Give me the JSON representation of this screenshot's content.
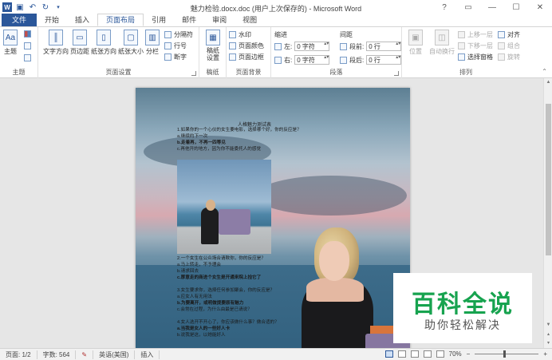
{
  "window": {
    "title": "魅力检验.docx.doc (用户上次保存的) - Microsoft Word",
    "controls": [
      "?",
      "▭",
      "—",
      "☐",
      "✕"
    ]
  },
  "quick_access": {
    "icons": [
      "word-icon",
      "save-icon",
      "undo-icon",
      "redo-icon",
      "customize-icon"
    ]
  },
  "tabs": [
    "文件",
    "开始",
    "插入",
    "页面布局",
    "引用",
    "邮件",
    "审阅",
    "视图"
  ],
  "active_tab": "页面布局",
  "ribbon": {
    "theme_group": {
      "label": "主题",
      "theme_button": "主题"
    },
    "page_setup": {
      "label": "页面设置",
      "buttons": [
        "文字方向",
        "页边距",
        "纸张方向",
        "纸张大小",
        "分栏"
      ],
      "breaks": "分隔符",
      "line_numbers": "行号",
      "hyphenation": "断字"
    },
    "manuscript": {
      "label": "稿纸",
      "button": "稿纸设置"
    },
    "page_background": {
      "label": "页面背景",
      "watermark": "水印",
      "page_color": "页面颜色",
      "page_borders": "页面边框"
    },
    "paragraph": {
      "label": "段落",
      "indent_title": "缩进",
      "spacing_title": "间距",
      "left_label": "左:",
      "right_label": "右:",
      "before_label": "段前:",
      "after_label": "段后:",
      "left_value": "0 字符",
      "right_value": "0 字符",
      "before_value": "0 行",
      "after_value": "0 行"
    },
    "arrange": {
      "label": "排列",
      "position": "位置",
      "wrap_text": "自动换行",
      "bring_forward": "上移一层",
      "send_backward": "下移一层",
      "selection_pane": "选择窗格",
      "align": "对齐",
      "group": "组合",
      "rotate": "旋转"
    }
  },
  "document": {
    "title": "人格魅力测试表",
    "lines_top": [
      {
        "text": "1.如果你的一个心仪的女生要电影，选择哪个好，你的反应是？",
        "bold": false
      },
      {
        "text": "a.继续约下一次",
        "bold": false
      },
      {
        "text": "b.走着再，不再一四等见",
        "bold": true
      },
      {
        "text": "c.再他开的地方，因为你不能委托人的感觉",
        "bold": false
      }
    ],
    "lines_bottom": [
      {
        "text": "2.一个女生在公众场合请欺你，你的反应是？",
        "bold": false
      },
      {
        "text": "a.马上转走，不予理会",
        "bold": false
      },
      {
        "text": "b.请求回去",
        "bold": false
      },
      {
        "text": "c.厚意走的商进个女生是开通来院上捡它了",
        "bold": true
      },
      {
        "text": "",
        "bold": false
      },
      {
        "text": "3.女生要求你，选择任何参加聚会，你的反应是？",
        "bold": false
      },
      {
        "text": "a.应女人有无用法",
        "bold": false
      },
      {
        "text": "b.为要离开，或明做提要原有魅力",
        "bold": true
      },
      {
        "text": "c.会常在过程，为什么由最是已请说？",
        "bold": false
      },
      {
        "text": "",
        "bold": false
      },
      {
        "text": "4.女人选开不开心了，你应该做什么事？做合适的？",
        "bold": false
      },
      {
        "text": "a.当我是女人的一些好人卡",
        "bold": true
      },
      {
        "text": "b.说我是这，以她能好人",
        "bold": false
      }
    ]
  },
  "watermark_logo": {
    "main": "百科全说",
    "sub": "助你轻松解决"
  },
  "status": {
    "page": "页面: 1/2",
    "words": "字数: 564",
    "language": "英语(美国)",
    "mode": "插入",
    "zoom": "70%",
    "zoom_fraction": 0.45
  },
  "colors": {
    "accent": "#2b579a",
    "file_tab": "#2b579a",
    "watermark_green": "#17a34f"
  }
}
